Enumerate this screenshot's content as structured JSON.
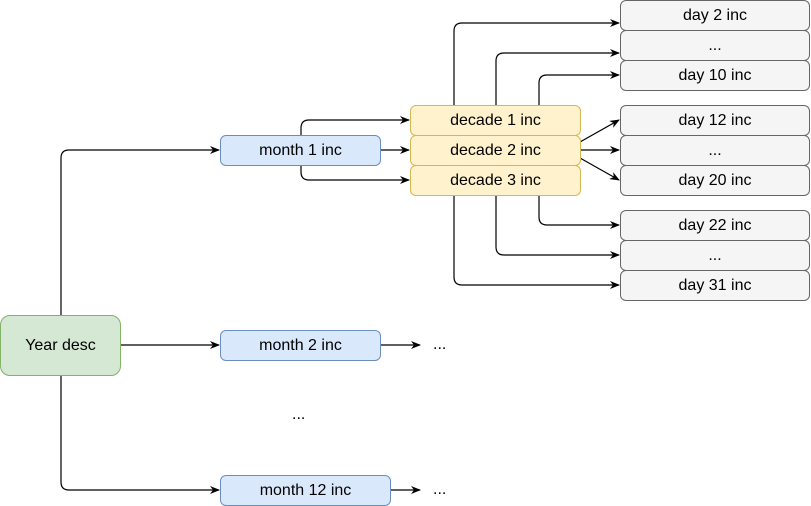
{
  "diagram": {
    "root": {
      "label": "Year desc",
      "color": "#d5e8d4"
    },
    "months": [
      {
        "label": "month 1 inc"
      },
      {
        "label": "month 2 inc",
        "continuation": "..."
      },
      {
        "label": "month 12 inc",
        "continuation": "..."
      }
    ],
    "months_ellipsis": "...",
    "decades": [
      {
        "label": "decade 1 inc"
      },
      {
        "label": "decade 2 inc"
      },
      {
        "label": "decade 3 inc"
      }
    ],
    "days": [
      {
        "label": "day 2 inc"
      },
      {
        "label": "..."
      },
      {
        "label": "day 10 inc"
      },
      {
        "label": "day 12 inc"
      },
      {
        "label": "..."
      },
      {
        "label": "day 20 inc"
      },
      {
        "label": "day 22 inc"
      },
      {
        "label": "..."
      },
      {
        "label": "day 31 inc"
      }
    ],
    "colors": {
      "year_fill": "#d5e8d4",
      "year_stroke": "#82b366",
      "month_fill": "#dae8fc",
      "month_stroke": "#6c8ebf",
      "decade_fill": "#fff2cc",
      "decade_stroke": "#d6b656",
      "day_fill": "#f5f5f5",
      "day_stroke": "#666666"
    }
  }
}
